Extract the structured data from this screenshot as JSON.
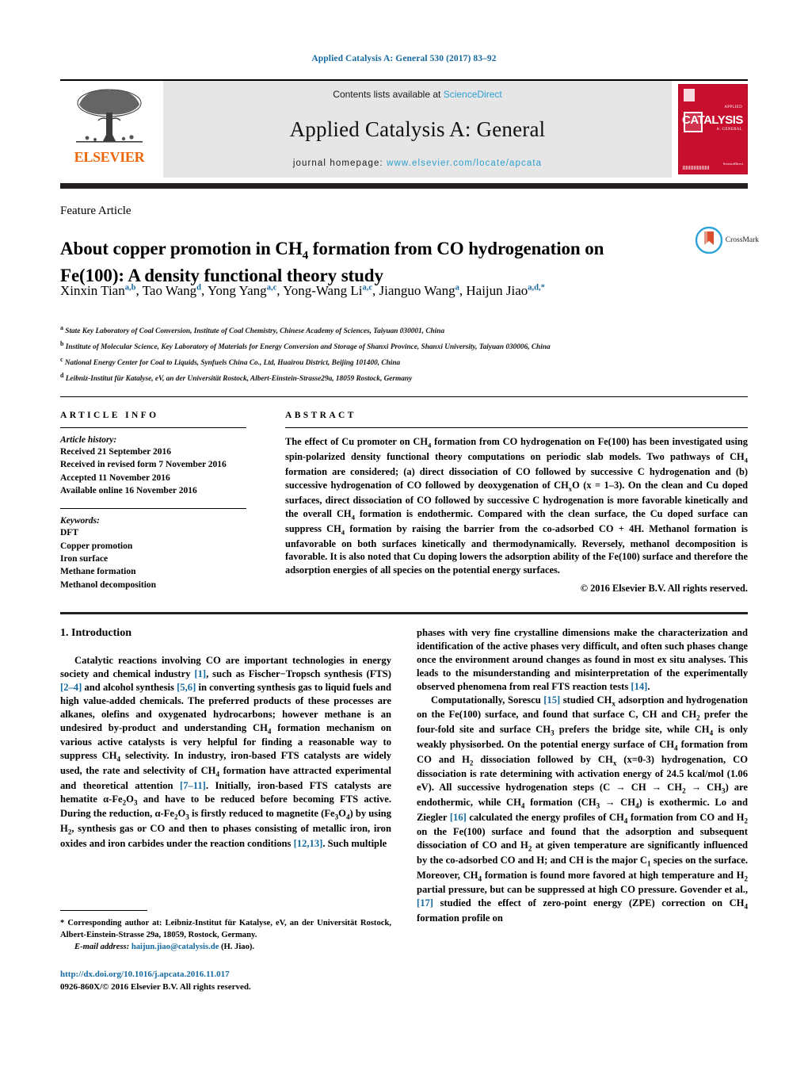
{
  "running_head": "Applied Catalysis A: General 530 (2017) 83–92",
  "masthead": {
    "contents_prefix": "Contents lists available at ",
    "contents_link": "ScienceDirect",
    "journal_title": "Applied Catalysis A: General",
    "homepage_prefix": "journal homepage: ",
    "homepage_url": "www.elsevier.com/locate/apcata",
    "publisher_word": "ELSEVIER",
    "cover": {
      "title": "CATALYSIS",
      "superline": "APPLIED",
      "subline": "A: GENERAL",
      "footer": "Available online at\nScienceDirect"
    },
    "colors": {
      "link": "#2e9fd0",
      "elsevier_orange": "#ec6608",
      "cover_red": "#c8102e",
      "band_grey": "#e6e6e6"
    }
  },
  "article": {
    "type_label": "Feature Article",
    "title_part1": "About copper promotion in CH",
    "title_sub1": "4",
    "title_part2": " formation from CO hydrogenation on Fe(100): A density functional theory study",
    "crossmark_label": "CrossMark",
    "authors": [
      {
        "name": "Xinxin Tian",
        "marks": "a,b",
        "sep": ", "
      },
      {
        "name": "Tao Wang",
        "marks": "d",
        "sep": ", "
      },
      {
        "name": "Yong Yang",
        "marks": "a,c",
        "sep": ", "
      },
      {
        "name": "Yong-Wang Li",
        "marks": "a,c",
        "sep": ", "
      },
      {
        "name": "Jianguo Wang",
        "marks": "a",
        "sep": ", "
      },
      {
        "name": "Haijun Jiao",
        "marks": "a,d,",
        "sep": ""
      }
    ],
    "affiliations": [
      {
        "mark": "a",
        "text": "State Key Laboratory of Coal Conversion, Institute of Coal Chemistry, Chinese Academy of Sciences, Taiyuan 030001, China"
      },
      {
        "mark": "b",
        "text": "Institute of Molecular Science, Key Laboratory of Materials for Energy Conversion and Storage of Shanxi Province, Shanxi University, Taiyuan 030006, China"
      },
      {
        "mark": "c",
        "text": "National Energy Center for Coal to Liquids, Synfuels China Co., Ltd, Huairou District, Beijing 101400, China"
      },
      {
        "mark": "d",
        "text": "Leibniz-Institut für Katalyse, eV, an der Universität Rostock, Albert-Einstein-Strasse29a, 18059 Rostock, Germany"
      }
    ]
  },
  "article_info": {
    "heading": "ARTICLE INFO",
    "history_label": "Article history:",
    "history": [
      "Received 21 September 2016",
      "Received in revised form 7 November 2016",
      "Accepted 11 November 2016",
      "Available online 16 November 2016"
    ],
    "keywords_label": "Keywords:",
    "keywords": [
      "DFT",
      "Copper promotion",
      "Iron surface",
      "Methane formation",
      "Methanol decomposition"
    ]
  },
  "abstract": {
    "heading": "ABSTRACT",
    "text": "The effect of Cu promoter on CH4 formation from CO hydrogenation on Fe(100) has been investigated using spin-polarized density functional theory computations on periodic slab models. Two pathways of CH4 formation are considered; (a) direct dissociation of CO followed by successive C hydrogenation and (b) successive hydrogenation of CO followed by deoxygenation of CHxO (x = 1–3). On the clean and Cu doped surfaces, direct dissociation of CO followed by successive C hydrogenation is more favorable kinetically and the overall CH4 formation is endothermic. Compared with the clean surface, the Cu doped surface can suppress CH4 formation by raising the barrier from the co-adsorbed CO + 4H. Methanol formation is unfavorable on both surfaces kinetically and thermodynamically. Reversely, methanol decomposition is favorable. It is also noted that Cu doping lowers the adsorption ability of the Fe(100) surface and therefore the adsorption energies of all species on the potential energy surfaces.",
    "copyright": "© 2016 Elsevier B.V. All rights reserved."
  },
  "body": {
    "section_number_title": "1. Introduction",
    "left_paragraph": "Catalytic reactions involving CO are important technologies in energy society and chemical industry [1], such as Fischer−Tropsch synthesis (FTS) [2–4] and alcohol synthesis [5,6] in converting synthesis gas to liquid fuels and high value-added chemicals. The preferred products of these processes are alkanes, olefins and oxygenated hydrocarbons; however methane is an undesired by-product and understanding CH4 formation mechanism on various active catalysts is very helpful for finding a reasonable way to suppress CH4 selectivity. In industry, iron-based FTS catalysts are widely used, the rate and selectivity of CH4 formation have attracted experimental and theoretical attention [7–11]. Initially, iron-based FTS catalysts are hematite α-Fe2O3 and have to be reduced before becoming FTS active. During the reduction, α-Fe2O3 is firstly reduced to magnetite (Fe3O4) by using H2, synthesis gas or CO and then to phases consisting of metallic iron, iron oxides and iron carbides under the reaction conditions [12,13]. Such multiple",
    "right_paragraph_1": "phases with very fine crystalline dimensions make the characterization and identification of the active phases very difficult, and often such phases change once the environment around changes as found in most ex situ analyses. This leads to the misunderstanding and misinterpretation of the experimentally observed phenomena from real FTS reaction tests [14].",
    "right_paragraph_2": "Computationally, Sorescu [15] studied CHx adsorption and hydrogenation on the Fe(100) surface, and found that surface C, CH and CH2 prefer the four-fold site and surface CH3 prefers the bridge site, while CH4 is only weakly physisorbed. On the potential energy surface of CH4 formation from CO and H2 dissociation followed by CHx (x=0-3) hydrogenation, CO dissociation is rate determining with activation energy of 24.5 kcal/mol (1.06 eV). All successive hydrogenation steps (C → CH → CH2 → CH3) are endothermic, while CH4 formation (CH3 → CH4) is exothermic. Lo and Ziegler [16] calculated the energy profiles of CH4 formation from CO and H2 on the Fe(100) surface and found that the adsorption and subsequent dissociation of CO and H2 at given temperature are significantly influenced by the co-adsorbed CO and H; and CH is the major C1 species on the surface. Moreover, CH4 formation is found more favored at high temperature and H2 partial pressure, but can be suppressed at high CO pressure. Govender et al., [17] studied the effect of zero-point energy (ZPE) correction on CH4 formation profile on"
  },
  "footer": {
    "corresponding_star": "*",
    "corresponding_text": "Corresponding author at: Leibniz-Institut für Katalyse, eV, an der Universität Rostock, Albert-Einstein-Strasse 29a, 18059, Rostock, Germany.",
    "email_label": "E-mail address:",
    "email": "haijun.jiao@catalysis.de",
    "email_suffix": "(H. Jiao).",
    "doi_url": "http://dx.doi.org/10.1016/j.apcata.2016.11.017",
    "issn_line": "0926-860X/© 2016 Elsevier B.V. All rights reserved."
  }
}
